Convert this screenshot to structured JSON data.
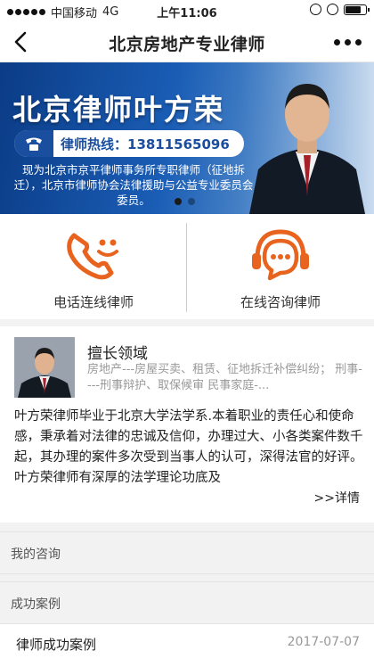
{
  "status_bar": {
    "carrier": "中国移动",
    "network": "4G",
    "time": "上午11:06",
    "battery_level": 0.8
  },
  "nav": {
    "title": "北京房地产专业律师",
    "back_icon": "chevron-left-icon",
    "more_icon": "more-dots-icon"
  },
  "banner": {
    "name": "北京律师叶方荣",
    "hotline": "律师热线：13811565096",
    "description": "现为北京市京平律师事务所专职律师（征地拆迁），北京市律师协会法律援助与公益专业委员会委员。",
    "slides": 2,
    "active_slide": 1
  },
  "actions": [
    {
      "label": "电话连线律师",
      "icon": "phone-smile-icon"
    },
    {
      "label": "在线咨询律师",
      "icon": "chat-headset-icon"
    }
  ],
  "profile": {
    "title": "擅长领域",
    "specialty": "房地产---房屋买卖、租赁、征地拆迁补偿纠纷；  刑事----刑事辩护、取保候审 民事家庭-...",
    "bio": "叶方荣律师毕业于北京大学法学系.本着职业的责任心和使命感，秉承着对法律的忠诚及信仰，办理过大、小各类案件数千起，其办理的案件多次受到当事人的认可，深得法官的好评。叶方荣律师有深厚的法学理论功底及",
    "more_label": ">>详情"
  },
  "sections": {
    "consult": "我的咨询",
    "cases": "成功案例"
  },
  "case_row": {
    "title": "律师成功案例",
    "date": "2017-07-07"
  },
  "colors": {
    "accent": "#e8641e",
    "banner_blue": "#1a5db5"
  }
}
